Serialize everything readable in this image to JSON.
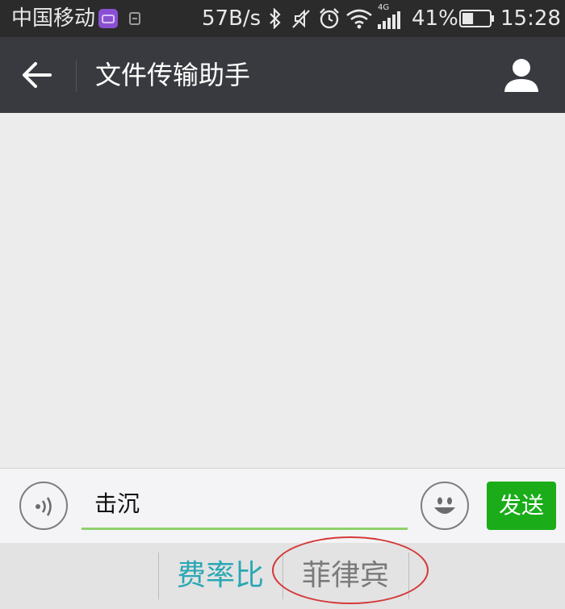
{
  "status_bar": {
    "carrier": "中国移动",
    "network_speed": "57B/s",
    "network_type": "4G",
    "battery_percent": "41%",
    "battery_level": 0.41,
    "time": "15:28",
    "icons": [
      "app-notification-icon",
      "sim-icon",
      "bluetooth-icon",
      "mute-icon",
      "alarm-icon",
      "wifi-icon",
      "signal-icon",
      "battery-icon"
    ]
  },
  "nav": {
    "title": "文件传输助手",
    "icons": [
      "back-arrow-icon",
      "profile-icon"
    ]
  },
  "input_bar": {
    "text_value": "击沉",
    "send_label": "发送",
    "icons": [
      "voice-icon",
      "emoji-icon"
    ]
  },
  "candidates": {
    "items": [
      "费率比",
      "菲律宾"
    ],
    "colors": {
      "highlight": "#2aa7b4",
      "normal": "#7a7a7a"
    }
  },
  "colors": {
    "status_bar_bg": "#2b2b2b",
    "nav_bg": "#393a3f",
    "send_button": "#1aad19",
    "input_underline": "#8fd06b",
    "annotation": "#d43a3a"
  }
}
